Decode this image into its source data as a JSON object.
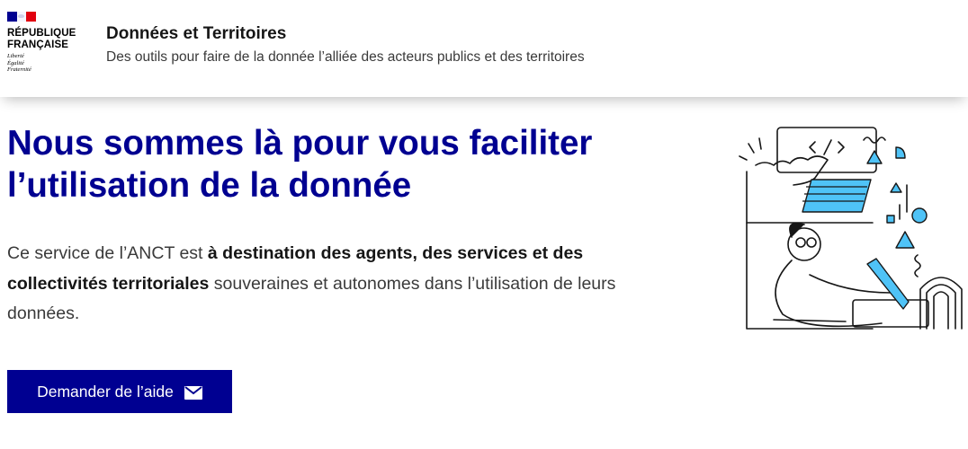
{
  "header": {
    "logo": {
      "name_line1": "RÉPUBLIQUE",
      "name_line2": "FRANÇAISE",
      "motto_line1": "Liberté",
      "motto_line2": "Égalité",
      "motto_line3": "Fraternité"
    },
    "service_title": "Données et Territoires",
    "service_tagline": "Des outils pour faire de la donnée l’alliée des acteurs publics et des territoires"
  },
  "hero": {
    "title_line1": "Nous sommes là pour vous faciliter",
    "title_line2": "l’utilisation de la donnée",
    "desc_part1": "Ce service de l’ANCT est ",
    "desc_bold1": "à destination des agents, des services et des collectivités territoriales",
    "desc_part2": " souveraines et autonomes dans l’utilisation de leurs données.",
    "cta_label": "Demander de l’aide",
    "cta_icon": "mail-icon"
  },
  "colors": {
    "brand_blue": "#000091",
    "marianne_red": "#e1000f",
    "illustration_accent": "#4fc3f7"
  }
}
